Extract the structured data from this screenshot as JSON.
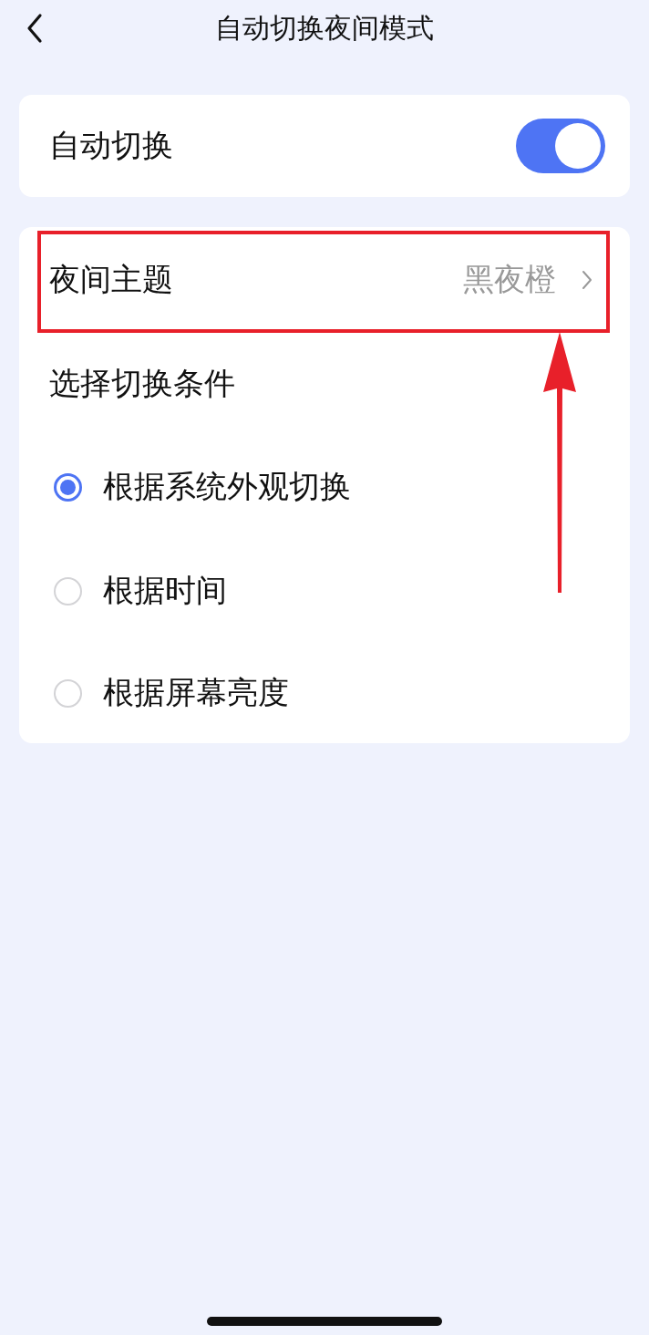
{
  "header": {
    "title": "自动切换夜间模式"
  },
  "auto_switch": {
    "label": "自动切换",
    "on": true
  },
  "night_theme": {
    "label": "夜间主题",
    "value": "黑夜橙",
    "highlighted": true
  },
  "condition_heading": "选择切换条件",
  "conditions": [
    {
      "label": "根据系统外观切换",
      "selected": true
    },
    {
      "label": "根据时间",
      "selected": false
    },
    {
      "label": "根据屏幕亮度",
      "selected": false
    }
  ]
}
